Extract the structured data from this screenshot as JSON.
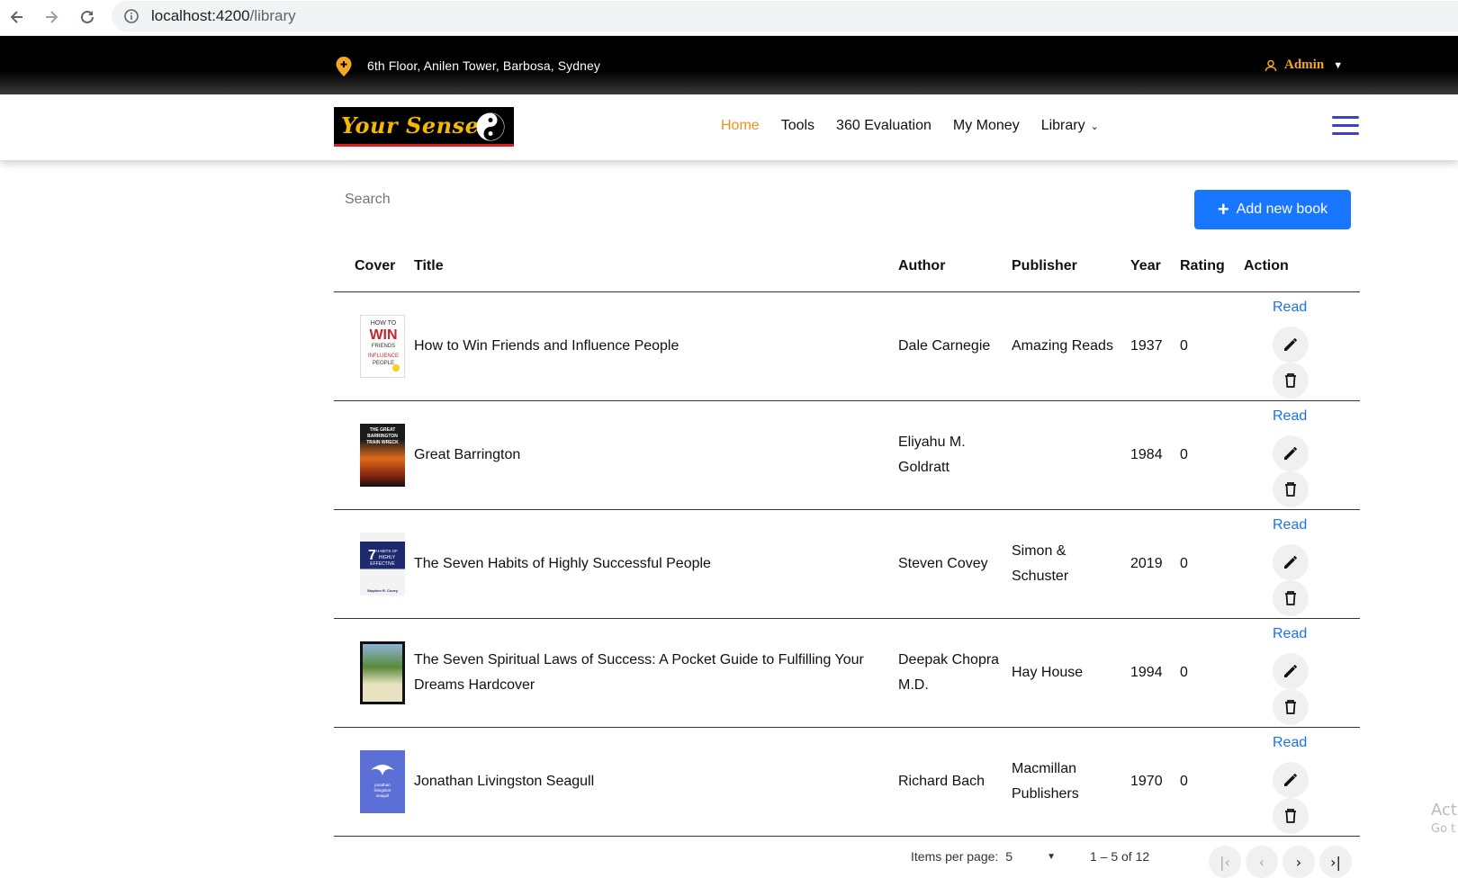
{
  "browser": {
    "url_host": "localhost:4200",
    "url_path": "/library"
  },
  "topbar": {
    "address": "6th Floor, Anilen Tower, Barbosa, Sydney",
    "user": "Admin"
  },
  "navbar": {
    "logo_text": "Your Sensei",
    "menu": [
      {
        "label": "Home",
        "active": true
      },
      {
        "label": "Tools"
      },
      {
        "label": "360 Evaluation"
      },
      {
        "label": "My Money"
      },
      {
        "label": "Library",
        "dropdown": true
      }
    ]
  },
  "toolbar": {
    "search_placeholder": "Search",
    "add_button_label": "Add new book"
  },
  "table": {
    "headers": {
      "cover": "Cover",
      "title": "Title",
      "author": "Author",
      "publisher": "Publisher",
      "year": "Year",
      "rating": "Rating",
      "action": "Action"
    },
    "read_label": "Read",
    "rows": [
      {
        "title": "How to Win Friends and Influence People",
        "author": "Dale Carnegie",
        "publisher": "Amazing Reads",
        "year": "1937",
        "rating": "0",
        "cover_color": "#ffffff"
      },
      {
        "title": "Great Barrington",
        "author": "Eliyahu M. Goldratt",
        "publisher": "",
        "year": "1984",
        "rating": "0",
        "cover_color": "#c1441b"
      },
      {
        "title": "The Seven Habits of Highly Successful People",
        "author": "Steven Covey",
        "publisher": "Simon & Schuster",
        "year": "2019",
        "rating": "0",
        "cover_color": "#1e2a6e"
      },
      {
        "title": "The Seven Spiritual Laws of Success: A Pocket Guide to Fulfilling Your Dreams Hardcover",
        "author": "Deepak Chopra M.D.",
        "publisher": "Hay House",
        "year": "1994",
        "rating": "0",
        "cover_color": "#2f4a1e"
      },
      {
        "title": "Jonathan Livingston Seagull",
        "author": "Richard Bach",
        "publisher": "Macmillan Publishers",
        "year": "1970",
        "rating": "0",
        "cover_color": "#5b6fd6"
      }
    ]
  },
  "paginator": {
    "items_per_page_label": "Items per page:",
    "items_per_page_value": "5",
    "range_label": "1 – 5 of 12"
  },
  "watermark": {
    "line1": "Act",
    "line2": "Go t"
  }
}
